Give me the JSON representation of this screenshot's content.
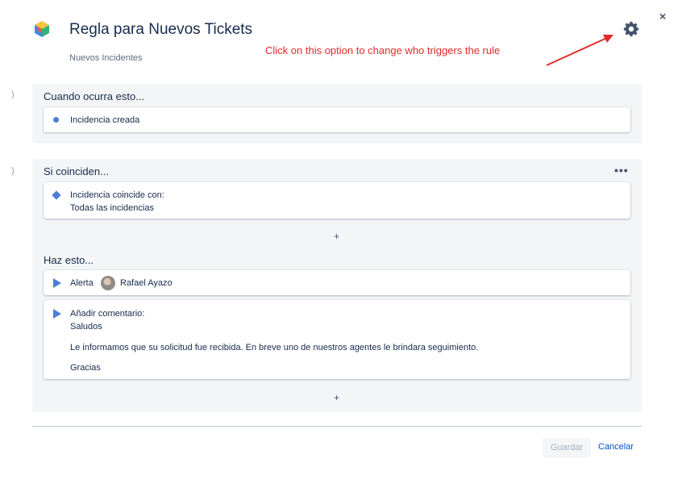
{
  "header": {
    "title": "Regla para Nuevos Tickets",
    "subtitle": "Nuevos Incidentes",
    "settings_icon": "gear-icon",
    "close_label": "×"
  },
  "annotation": {
    "text": "Click on this option to change who triggers the rule",
    "color": "#e22b2b"
  },
  "edge_markers": [
    ")",
    ")"
  ],
  "trigger": {
    "label": "Cuando ocurra esto...",
    "item": "Incidencia creada"
  },
  "conditions": {
    "label": "Si coinciden...",
    "more": "•••",
    "item_line1": "Incidencia coincide con:",
    "item_line2": "Todas las incidencias",
    "add": "+"
  },
  "actions": {
    "label": "Haz esto...",
    "alert_label": "Alerta",
    "alert_user": "Rafael Ayazo",
    "comment_title": "Añadir comentario:",
    "comment_greeting": "Saludos",
    "comment_body": "Le informamos que su solicitud fue recibida. En breve uno de nuestros agentes le brindara seguimiento.",
    "comment_closing": "Gracias",
    "add": "+"
  },
  "footer": {
    "save_label": "Guardar",
    "cancel_label": "Cancelar"
  },
  "colors": {
    "accent": "#4c7dd8",
    "link": "#0052cc",
    "section_bg": "#f4f5f7"
  }
}
